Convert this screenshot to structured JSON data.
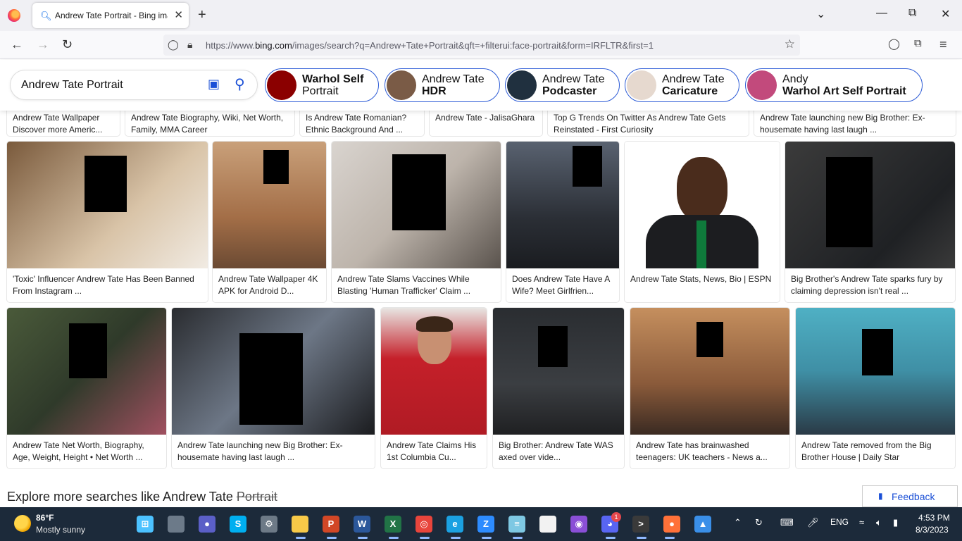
{
  "browser": {
    "tab_title": "Andrew Tate Portrait - Bing images",
    "tab_close": "✕",
    "new_tab": "+",
    "url_prefix": "https://www.",
    "url_host": "bing.com",
    "url_path": "/images/search?q=Andrew+Tate+Portrait&qft=+filterui:face-portrait&form=IRFLTR&first=1"
  },
  "search": {
    "query": "Andrew Tate Portrait"
  },
  "related_chips": [
    {
      "line1": "Warhol Self",
      "line2": "Portrait",
      "bold_line": 1,
      "thumb": "#8b0000"
    },
    {
      "line1": "Andrew Tate",
      "line2": "HDR",
      "bold_line": 2,
      "thumb": "#7a5b46"
    },
    {
      "line1": "Andrew Tate",
      "line2": "Podcaster",
      "bold_line": 2,
      "thumb": "#20303f"
    },
    {
      "line1": "Andrew Tate",
      "line2": "Caricature",
      "bold_line": 2,
      "thumb": "#e6d9cf"
    },
    {
      "line1": "Andy",
      "line2": "Warhol Art Self Portrait",
      "bold_line": 2,
      "thumb": "#c24a7c"
    }
  ],
  "results": {
    "row0": [
      {
        "caption": "Andrew Tate Wallpaper Discover more Americ..."
      },
      {
        "caption": "Andrew Tate Biography, Wiki, Net Worth, Family, MMA Career"
      },
      {
        "caption": "Is Andrew Tate Romanian? Ethnic Background And ..."
      },
      {
        "caption": "Andrew Tate - JalisaGhara"
      },
      {
        "caption": "Top G Trends On Twitter As Andrew Tate Gets Reinstated - First Curiosity"
      },
      {
        "caption": "Andrew Tate launching new Big Brother: Ex-housemate having last laugh ..."
      }
    ],
    "row1": [
      {
        "caption": "'Toxic' Influencer Andrew Tate Has Been Banned From Instagram ..."
      },
      {
        "caption": "Andrew Tate Wallpaper 4K APK for Android D..."
      },
      {
        "caption": "Andrew Tate Slams Vaccines While Blasting 'Human Trafficker' Claim ..."
      },
      {
        "caption": "Does Andrew Tate Have A Wife? Meet Girlfrien..."
      },
      {
        "caption": "Andrew Tate Stats, News, Bio | ESPN"
      },
      {
        "caption": "Big Brother's Andrew Tate sparks fury by claiming depression isn't real ..."
      }
    ],
    "row2": [
      {
        "caption": "Andrew Tate Net Worth, Biography, Age, Weight, Height • Net Worth ..."
      },
      {
        "caption": "Andrew Tate launching new Big Brother: Ex-housemate having last laugh ..."
      },
      {
        "caption": "Andrew Tate Claims His 1st Columbia Cu..."
      },
      {
        "caption": "Big Brother: Andrew Tate WAS axed over vide..."
      },
      {
        "caption": "Andrew Tate has brainwashed teenagers: UK teachers - News a..."
      },
      {
        "caption": "Andrew Tate removed from the Big Brother House | Daily Star"
      }
    ]
  },
  "explore": {
    "text": "Explore more searches like Andrew Tate",
    "struck": "Portrait"
  },
  "feedback_label": "Feedback",
  "taskbar": {
    "temp": "86°F",
    "weather": "Mostly sunny",
    "lang": "ENG",
    "time": "4:53 PM",
    "date": "8/3/2023",
    "discord_badge": "1"
  }
}
